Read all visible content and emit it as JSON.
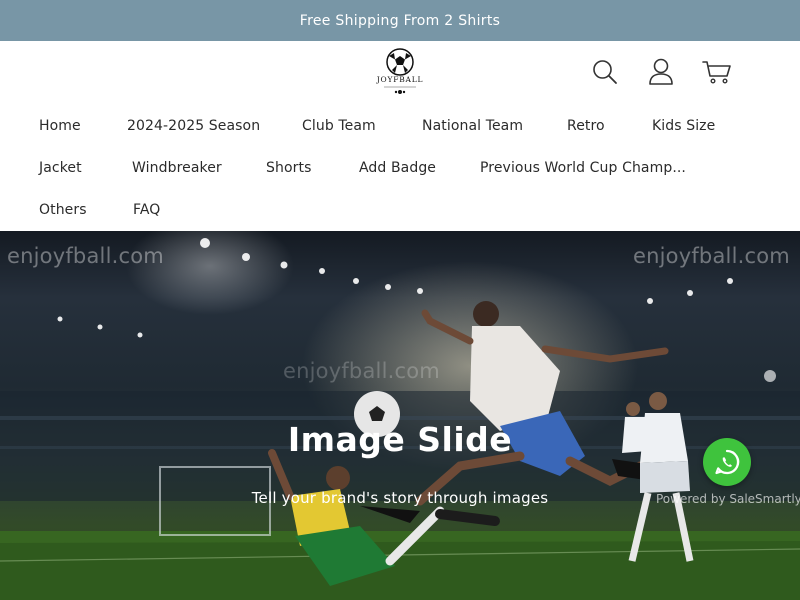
{
  "announcement": {
    "text": "Free Shipping From 2 Shirts"
  },
  "logo": {
    "brand": "JOYFBALL",
    "icon": "soccer-ball-logo"
  },
  "header_icons": [
    {
      "name": "search-icon"
    },
    {
      "name": "account-icon"
    },
    {
      "name": "cart-icon"
    }
  ],
  "nav": {
    "items": [
      "Home",
      "2024-2025 Season",
      "Club Team",
      "National Team",
      "Retro",
      "Kids Size",
      "Jacket",
      "Windbreaker",
      "Shorts",
      "Add Badge",
      "Previous World Cup Champ...",
      "Others",
      "FAQ"
    ]
  },
  "hero": {
    "watermark": "enjoyfball.com",
    "title": "Image Slide",
    "subtitle": "Tell your brand's story through images"
  },
  "chat_widget": {
    "icon": "whatsapp-icon",
    "powered_by": "Powered by SaleSmartly"
  },
  "colors": {
    "announcement_bg": "#7896a6",
    "whatsapp": "#3fc33d",
    "nav_text": "#2b2b2b"
  }
}
